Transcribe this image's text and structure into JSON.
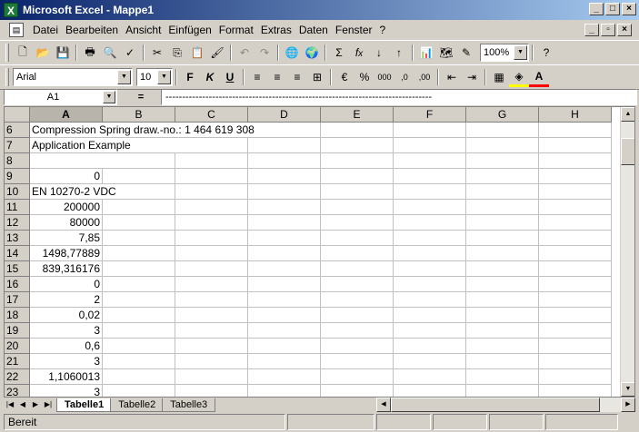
{
  "window": {
    "title": "Microsoft Excel - Mappe1"
  },
  "menu": [
    "Datei",
    "Bearbeiten",
    "Ansicht",
    "Einfügen",
    "Format",
    "Extras",
    "Daten",
    "Fenster",
    "?"
  ],
  "toolbar": {
    "zoom": "100%",
    "font_name": "Arial",
    "font_size": "10"
  },
  "formula_bar": {
    "name_box": "A1",
    "equals": "=",
    "content": "--------------------------------------------------------------------------------"
  },
  "sheet": {
    "columns": [
      "A",
      "B",
      "C",
      "D",
      "E",
      "F",
      "G",
      "H"
    ],
    "active_column": "A",
    "rows": [
      {
        "num": "6",
        "a": "Compression Spring   draw.-no.: 1 464 619 308",
        "type": "text"
      },
      {
        "num": "7",
        "a": "Application Example",
        "type": "text"
      },
      {
        "num": "8",
        "a": "",
        "type": "text"
      },
      {
        "num": "9",
        "a": "0",
        "type": "num"
      },
      {
        "num": "10",
        "a": "EN 10270-2 VDC",
        "type": "text"
      },
      {
        "num": "11",
        "a": "200000",
        "type": "num"
      },
      {
        "num": "12",
        "a": "80000",
        "type": "num"
      },
      {
        "num": "13",
        "a": "7,85",
        "type": "num"
      },
      {
        "num": "14",
        "a": "1498,77889",
        "type": "num"
      },
      {
        "num": "15",
        "a": "839,316176",
        "type": "num"
      },
      {
        "num": "16",
        "a": "0",
        "type": "num"
      },
      {
        "num": "17",
        "a": "2",
        "type": "num"
      },
      {
        "num": "18",
        "a": "0,02",
        "type": "num"
      },
      {
        "num": "19",
        "a": "3",
        "type": "num"
      },
      {
        "num": "20",
        "a": "0,6",
        "type": "num"
      },
      {
        "num": "21",
        "a": "3",
        "type": "num"
      },
      {
        "num": "22",
        "a": "1,1060013",
        "type": "num"
      },
      {
        "num": "23",
        "a": "3",
        "type": "num"
      }
    ]
  },
  "tabs": [
    "Tabelle1",
    "Tabelle2",
    "Tabelle3"
  ],
  "active_tab": "Tabelle1",
  "status": {
    "text": "Bereit"
  }
}
